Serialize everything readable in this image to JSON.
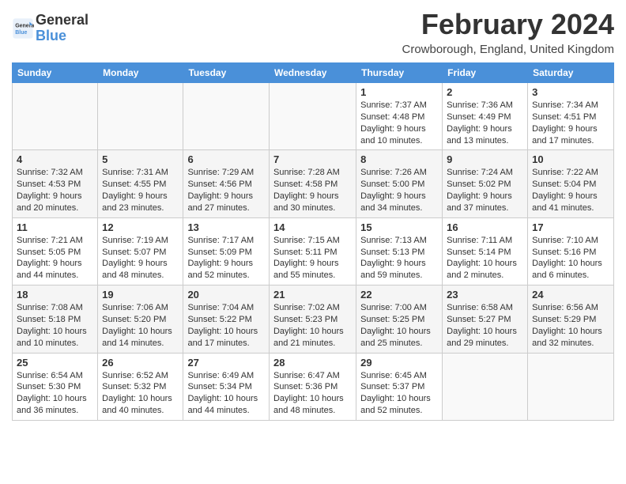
{
  "header": {
    "logo_line1": "General",
    "logo_line2": "Blue",
    "month_year": "February 2024",
    "location": "Crowborough, England, United Kingdom"
  },
  "days_of_week": [
    "Sunday",
    "Monday",
    "Tuesday",
    "Wednesday",
    "Thursday",
    "Friday",
    "Saturday"
  ],
  "weeks": [
    [
      {
        "day": "",
        "info": ""
      },
      {
        "day": "",
        "info": ""
      },
      {
        "day": "",
        "info": ""
      },
      {
        "day": "",
        "info": ""
      },
      {
        "day": "1",
        "info": "Sunrise: 7:37 AM\nSunset: 4:48 PM\nDaylight: 9 hours and 10 minutes."
      },
      {
        "day": "2",
        "info": "Sunrise: 7:36 AM\nSunset: 4:49 PM\nDaylight: 9 hours and 13 minutes."
      },
      {
        "day": "3",
        "info": "Sunrise: 7:34 AM\nSunset: 4:51 PM\nDaylight: 9 hours and 17 minutes."
      }
    ],
    [
      {
        "day": "4",
        "info": "Sunrise: 7:32 AM\nSunset: 4:53 PM\nDaylight: 9 hours and 20 minutes."
      },
      {
        "day": "5",
        "info": "Sunrise: 7:31 AM\nSunset: 4:55 PM\nDaylight: 9 hours and 23 minutes."
      },
      {
        "day": "6",
        "info": "Sunrise: 7:29 AM\nSunset: 4:56 PM\nDaylight: 9 hours and 27 minutes."
      },
      {
        "day": "7",
        "info": "Sunrise: 7:28 AM\nSunset: 4:58 PM\nDaylight: 9 hours and 30 minutes."
      },
      {
        "day": "8",
        "info": "Sunrise: 7:26 AM\nSunset: 5:00 PM\nDaylight: 9 hours and 34 minutes."
      },
      {
        "day": "9",
        "info": "Sunrise: 7:24 AM\nSunset: 5:02 PM\nDaylight: 9 hours and 37 minutes."
      },
      {
        "day": "10",
        "info": "Sunrise: 7:22 AM\nSunset: 5:04 PM\nDaylight: 9 hours and 41 minutes."
      }
    ],
    [
      {
        "day": "11",
        "info": "Sunrise: 7:21 AM\nSunset: 5:05 PM\nDaylight: 9 hours and 44 minutes."
      },
      {
        "day": "12",
        "info": "Sunrise: 7:19 AM\nSunset: 5:07 PM\nDaylight: 9 hours and 48 minutes."
      },
      {
        "day": "13",
        "info": "Sunrise: 7:17 AM\nSunset: 5:09 PM\nDaylight: 9 hours and 52 minutes."
      },
      {
        "day": "14",
        "info": "Sunrise: 7:15 AM\nSunset: 5:11 PM\nDaylight: 9 hours and 55 minutes."
      },
      {
        "day": "15",
        "info": "Sunrise: 7:13 AM\nSunset: 5:13 PM\nDaylight: 9 hours and 59 minutes."
      },
      {
        "day": "16",
        "info": "Sunrise: 7:11 AM\nSunset: 5:14 PM\nDaylight: 10 hours and 2 minutes."
      },
      {
        "day": "17",
        "info": "Sunrise: 7:10 AM\nSunset: 5:16 PM\nDaylight: 10 hours and 6 minutes."
      }
    ],
    [
      {
        "day": "18",
        "info": "Sunrise: 7:08 AM\nSunset: 5:18 PM\nDaylight: 10 hours and 10 minutes."
      },
      {
        "day": "19",
        "info": "Sunrise: 7:06 AM\nSunset: 5:20 PM\nDaylight: 10 hours and 14 minutes."
      },
      {
        "day": "20",
        "info": "Sunrise: 7:04 AM\nSunset: 5:22 PM\nDaylight: 10 hours and 17 minutes."
      },
      {
        "day": "21",
        "info": "Sunrise: 7:02 AM\nSunset: 5:23 PM\nDaylight: 10 hours and 21 minutes."
      },
      {
        "day": "22",
        "info": "Sunrise: 7:00 AM\nSunset: 5:25 PM\nDaylight: 10 hours and 25 minutes."
      },
      {
        "day": "23",
        "info": "Sunrise: 6:58 AM\nSunset: 5:27 PM\nDaylight: 10 hours and 29 minutes."
      },
      {
        "day": "24",
        "info": "Sunrise: 6:56 AM\nSunset: 5:29 PM\nDaylight: 10 hours and 32 minutes."
      }
    ],
    [
      {
        "day": "25",
        "info": "Sunrise: 6:54 AM\nSunset: 5:30 PM\nDaylight: 10 hours and 36 minutes."
      },
      {
        "day": "26",
        "info": "Sunrise: 6:52 AM\nSunset: 5:32 PM\nDaylight: 10 hours and 40 minutes."
      },
      {
        "day": "27",
        "info": "Sunrise: 6:49 AM\nSunset: 5:34 PM\nDaylight: 10 hours and 44 minutes."
      },
      {
        "day": "28",
        "info": "Sunrise: 6:47 AM\nSunset: 5:36 PM\nDaylight: 10 hours and 48 minutes."
      },
      {
        "day": "29",
        "info": "Sunrise: 6:45 AM\nSunset: 5:37 PM\nDaylight: 10 hours and 52 minutes."
      },
      {
        "day": "",
        "info": ""
      },
      {
        "day": "",
        "info": ""
      }
    ]
  ]
}
